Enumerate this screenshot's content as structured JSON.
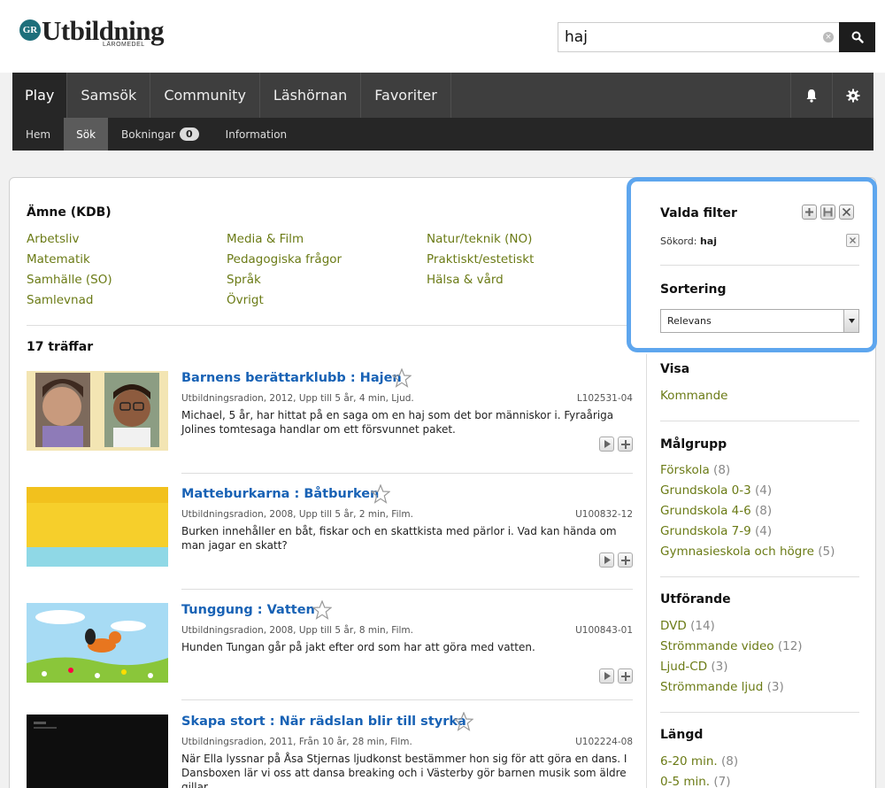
{
  "header": {
    "logo_badge": "GR",
    "logo_text": "Utbildning",
    "logo_sub": "LÄROMEDEL",
    "search_value": "haj"
  },
  "nav": {
    "items": [
      "Play",
      "Samsök",
      "Community",
      "Läshörnan",
      "Favoriter"
    ]
  },
  "subnav": {
    "items": [
      "Hem",
      "Sök",
      "Bokningar",
      "Information"
    ],
    "bookings_count": "0"
  },
  "subjects": {
    "title": "Ämne (KDB)",
    "col1": [
      "Arbetsliv",
      "Matematik",
      "Samhälle (SO)",
      "Samlevnad"
    ],
    "col2": [
      "Media & Film",
      "Pedagogiska frågor",
      "Språk",
      "Övrigt"
    ],
    "col3": [
      "Natur/teknik (NO)",
      "Praktiskt/estetiskt",
      "Hälsa & vård"
    ]
  },
  "results": {
    "hits_label": "17 träffar",
    "items": [
      {
        "title": "Barnens berättarklubb : Hajen",
        "meta": "Utbildningsradion, 2012, Upp till 5 år, 4 min, Ljud.",
        "id": "L102531-04",
        "desc": "Michael, 5 år, har hittat på en saga om en haj som det bor människor i. Fyraåriga Jolines tomtesaga handlar om ett försvunnet paket."
      },
      {
        "title": "Matteburkarna : Båtburken",
        "meta": "Utbildningsradion, 2008, Upp till 5 år, 2 min, Film.",
        "id": "U100832-12",
        "desc": "Burken innehåller en båt, fiskar och en skattkista med pärlor i. Vad kan hända om man jagar en skatt?"
      },
      {
        "title": "Tunggung : Vatten",
        "meta": "Utbildningsradion, 2008, Upp till 5 år, 8 min, Film.",
        "id": "U100843-01",
        "desc": "Hunden Tungan går på jakt efter ord som har att göra med vatten."
      },
      {
        "title": "Skapa stort : När rädslan blir till styrka",
        "meta": "Utbildningsradion, 2011, Från 10 år, 28 min, Film.",
        "id": "U102224-08",
        "desc": "När Ella lyssnar på Åsa Stjernas ljudkonst bestämmer hon sig för att göra en dans. I Dansboxen lär vi oss att dansa breaking och i Västerby gör barnen musik som äldre gillar."
      }
    ]
  },
  "filters": {
    "title": "Valda filter",
    "term_label": "Sökord:",
    "term_value": "haj",
    "sort_title": "Sortering",
    "sort_value": "Relevans"
  },
  "sidebar": {
    "visa": {
      "title": "Visa",
      "items": [
        {
          "label": "Kommande",
          "count": ""
        }
      ]
    },
    "malgrupp": {
      "title": "Målgrupp",
      "items": [
        {
          "label": "Förskola",
          "count": "(8)"
        },
        {
          "label": "Grundskola 0-3",
          "count": "(4)"
        },
        {
          "label": "Grundskola 4-6",
          "count": "(8)"
        },
        {
          "label": "Grundskola 7-9",
          "count": "(4)"
        },
        {
          "label": "Gymnasieskola och högre",
          "count": "(5)"
        }
      ]
    },
    "utforande": {
      "title": "Utförande",
      "items": [
        {
          "label": "DVD",
          "count": "(14)"
        },
        {
          "label": "Strömmande video",
          "count": "(12)"
        },
        {
          "label": "Ljud-CD",
          "count": "(3)"
        },
        {
          "label": "Strömmande ljud",
          "count": "(3)"
        }
      ]
    },
    "langd": {
      "title": "Längd",
      "items": [
        {
          "label": "6-20 min.",
          "count": "(8)"
        },
        {
          "label": "0-5 min.",
          "count": "(7)"
        }
      ]
    }
  }
}
